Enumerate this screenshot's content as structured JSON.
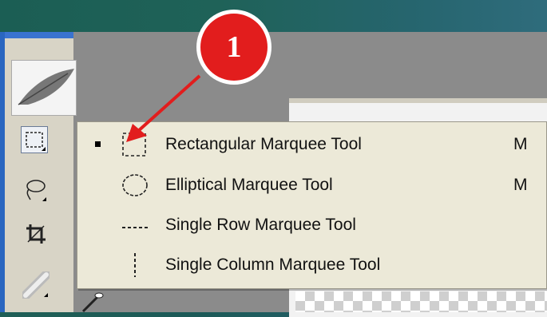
{
  "callout": {
    "number": "1",
    "color": "#e21d1d"
  },
  "flyout_menu": {
    "items": [
      {
        "label": "Rectangular Marquee Tool",
        "shortcut": "M",
        "selected": true,
        "icon": "rectangular-marquee-icon"
      },
      {
        "label": "Elliptical Marquee Tool",
        "shortcut": "M",
        "selected": false,
        "icon": "elliptical-marquee-icon"
      },
      {
        "label": "Single Row Marquee Tool",
        "shortcut": "",
        "selected": false,
        "icon": "single-row-marquee-icon"
      },
      {
        "label": "Single Column Marquee Tool",
        "shortcut": "",
        "selected": false,
        "icon": "single-column-marquee-icon"
      }
    ]
  },
  "toolbox": {
    "tools": [
      "marquee-tool",
      "lasso-tool",
      "crop-tool",
      "healing-brush-tool",
      "brush-tool"
    ],
    "accent": "#2a66c0"
  }
}
